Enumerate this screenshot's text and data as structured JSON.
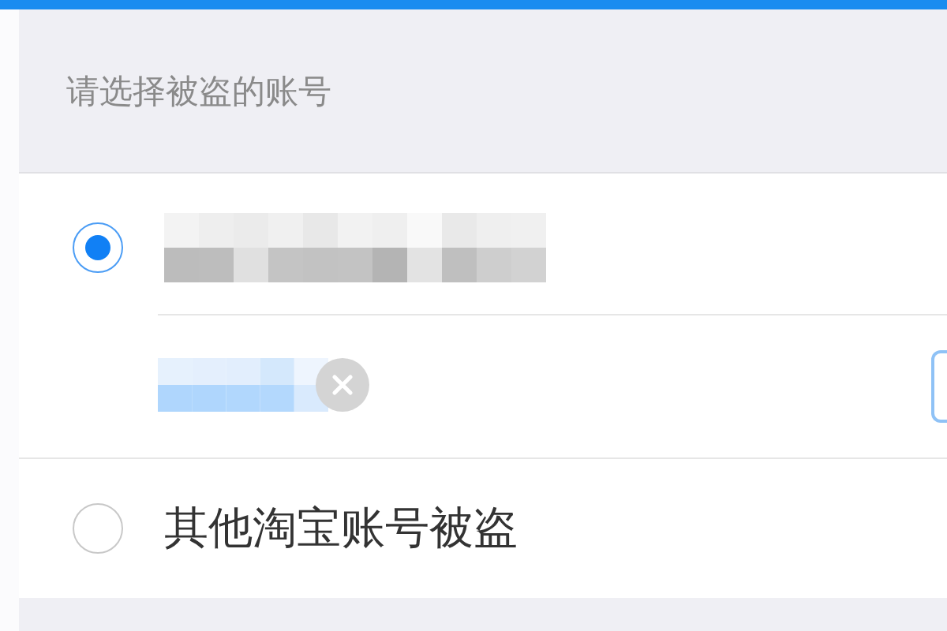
{
  "section_header": {
    "title": "请选择被盗的账号"
  },
  "accounts": [
    {
      "kind": "masked",
      "selected": true
    },
    {
      "kind": "text",
      "label": "其他淘宝账号被盗",
      "selected": false
    }
  ]
}
